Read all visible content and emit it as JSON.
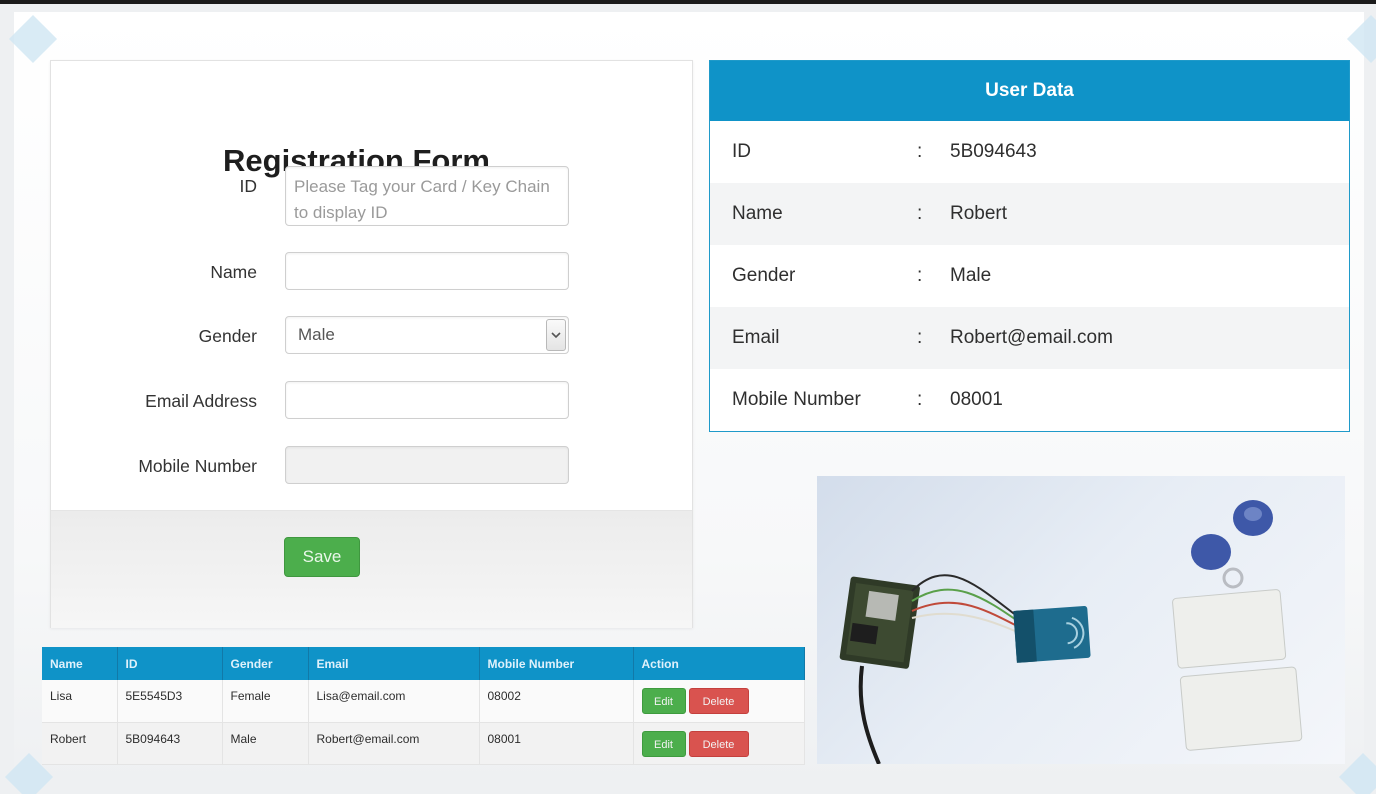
{
  "form": {
    "title": "Registration Form",
    "id_label": "ID",
    "id_placeholder": "Please Tag your Card / Key Chain to display ID",
    "name_label": "Name",
    "name_value": "",
    "gender_label": "Gender",
    "gender_value": "Male",
    "email_label": "Email Address",
    "email_value": "",
    "mobile_label": "Mobile Number",
    "mobile_value": "",
    "save_label": "Save"
  },
  "user_data": {
    "title": "User Data",
    "separator": ":",
    "rows": [
      {
        "label": "ID",
        "value": "5B094643"
      },
      {
        "label": "Name",
        "value": "Robert"
      },
      {
        "label": "Gender",
        "value": "Male"
      },
      {
        "label": "Email",
        "value": "Robert@email.com"
      },
      {
        "label": "Mobile Number",
        "value": "08001"
      }
    ]
  },
  "table": {
    "headers": [
      "Name",
      "ID",
      "Gender",
      "Email",
      "Mobile Number",
      "Action"
    ],
    "rows": [
      {
        "name": "Lisa",
        "id": "5E5545D3",
        "gender": "Female",
        "email": "Lisa@email.com",
        "mobile": "08002",
        "edit": "Edit",
        "delete": "Delete"
      },
      {
        "name": "Robert",
        "id": "5B094643",
        "gender": "Male",
        "email": "Robert@email.com",
        "mobile": "08001",
        "edit": "Edit",
        "delete": "Delete"
      }
    ]
  },
  "photo": {
    "description_icon": "rfid-hardware-photo"
  },
  "colors": {
    "accent": "#0f93c8",
    "save_green": "#4cae4c",
    "delete_red": "#d9534f"
  }
}
